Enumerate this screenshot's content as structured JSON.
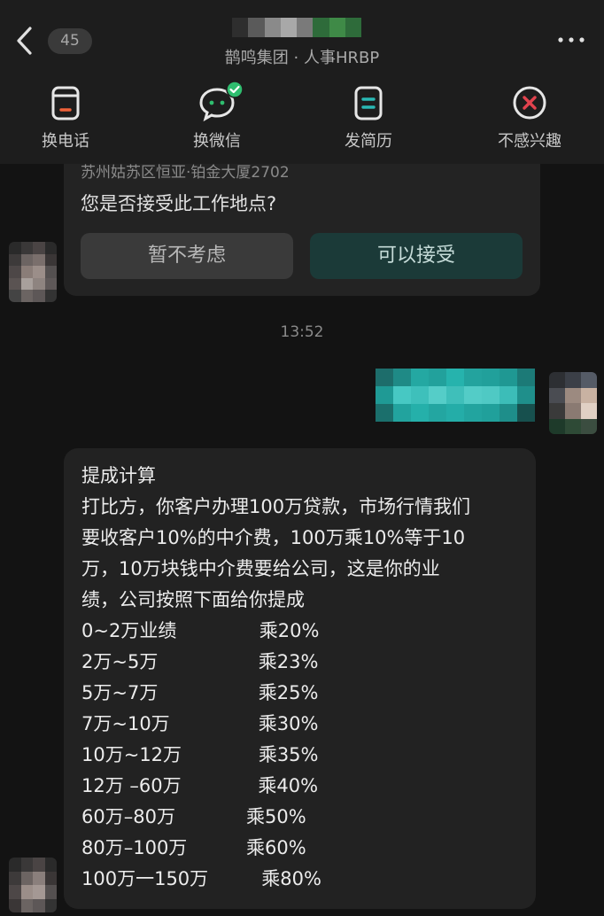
{
  "header": {
    "unread_count": "45",
    "subtitle": "鹊鸣集团 · 人事HRBP",
    "actions": [
      {
        "label": "换电话",
        "icon": "phone-icon"
      },
      {
        "label": "换微信",
        "icon": "wechat-icon"
      },
      {
        "label": "发简历",
        "icon": "resume-icon"
      },
      {
        "label": "不感兴趣",
        "icon": "not-interested-icon"
      }
    ]
  },
  "location_card": {
    "address": "苏州姑苏区恒亚·铂金大厦2702",
    "question": "您是否接受此工作地点?",
    "decline_label": "暂不考虑",
    "accept_label": "可以接受"
  },
  "timestamp": "13:52",
  "message": {
    "lines": [
      "提成计算",
      "打比方，你客户办理100万贷款，市场行情我们",
      "要收客户10%的中介费，100万乘10%等于10",
      "万，10万块钱中介费要给公司，这是你的业",
      "绩，公司按照下面给你提成",
      "0~2万业绩              乘20%",
      "2万~5万                 乘23%",
      "5万~7万                 乘25%",
      "7万~10万               乘30%",
      "10万~12万             乘35%",
      "12万 –60万             乘40%",
      "60万–80万            乘50%",
      "80万–100万          乘60%",
      "100万一150万         乘80%"
    ]
  },
  "colors": {
    "background": "#131313",
    "header": "#1d1d1d",
    "accent_orange": "#f0623a",
    "accent_teal": "#2ab8b4",
    "accent_green": "#2fbd6f",
    "accent_red": "#e2434e"
  }
}
